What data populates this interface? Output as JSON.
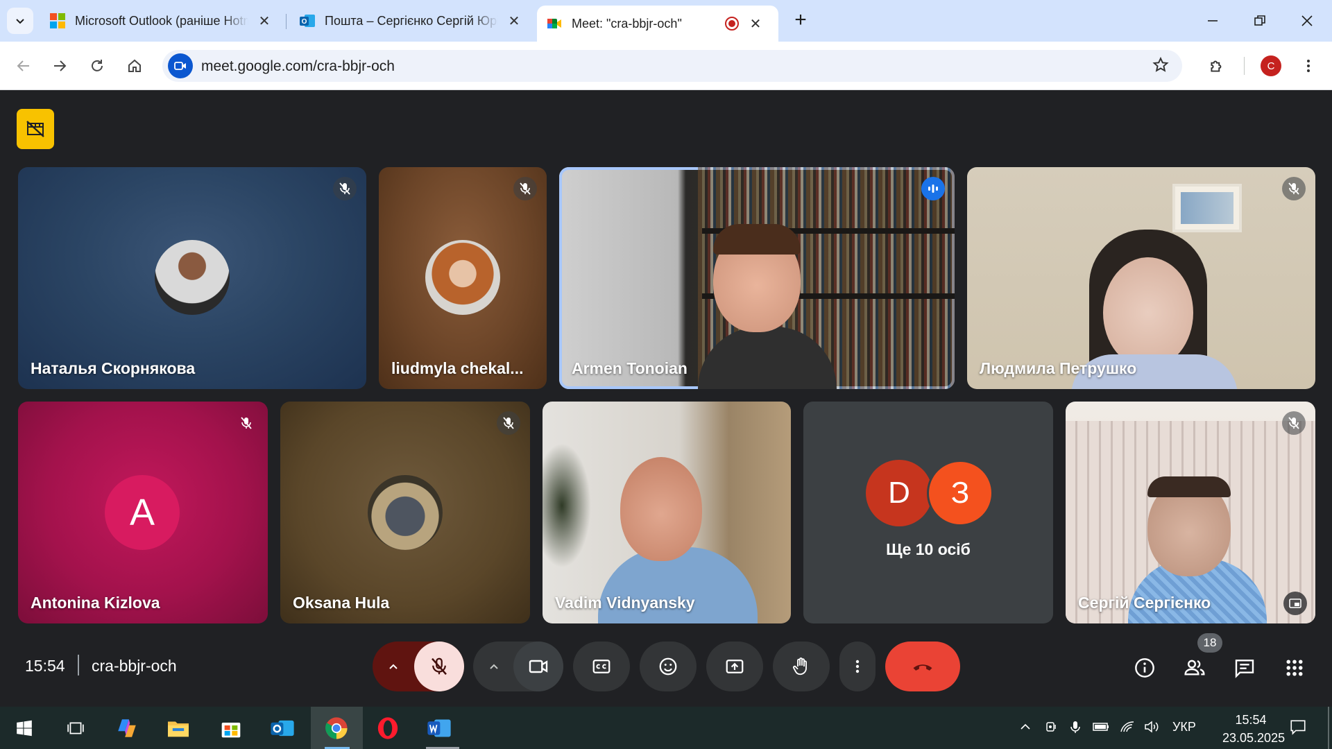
{
  "browser": {
    "tabs": [
      {
        "title": "Microsoft Outlook (раніше Hotmail)",
        "icon": "microsoft-icon"
      },
      {
        "title": "Пошта – Сергієнко Сергій Юрійович",
        "icon": "outlook-icon"
      },
      {
        "title": "Meet: \"cra-bbjr-och\"",
        "icon": "meet-icon",
        "active": true
      }
    ],
    "new_tab": "+",
    "url": "meet.google.com/cra-bbjr-och",
    "profile_initial": "C",
    "accent": "#0b57d0"
  },
  "meet": {
    "participants": [
      {
        "name": "Наталья Скорнякова",
        "muted": true
      },
      {
        "name": "liudmyla chekal...",
        "muted": true
      },
      {
        "name": "Armen Tonoian",
        "speaking": true
      },
      {
        "name": "Людмила Петрушко",
        "muted": true
      },
      {
        "name": "Antonina Kizlova",
        "muted": true,
        "initial": "A"
      },
      {
        "name": "Oksana Hula",
        "muted": true
      },
      {
        "name": "Vadim Vidnyansky"
      },
      {
        "name": "Сергій Сергієнко",
        "muted": true
      }
    ],
    "others": {
      "initials": [
        "D",
        "З"
      ],
      "label": "Ще 10 осіб"
    },
    "time": "15:54",
    "meeting_code": "cra-bbjr-och",
    "people_count": "18",
    "end_call_color": "#ea4335"
  },
  "taskbar": {
    "language": "УКР",
    "time": "15:54",
    "date": "23.05.2025"
  }
}
